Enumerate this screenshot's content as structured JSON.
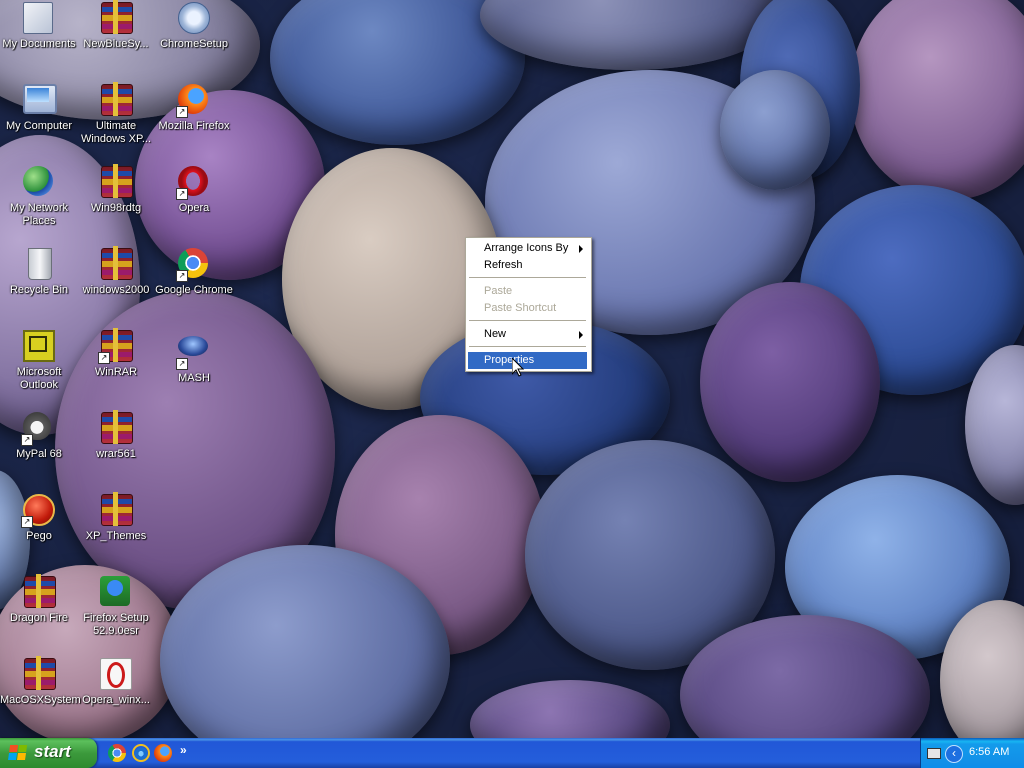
{
  "desktop": {
    "icons": [
      {
        "label": "My Documents",
        "icon": "my-documents-icon"
      },
      {
        "label": "NewBlueSy...",
        "icon": "winrar-archive-icon"
      },
      {
        "label": "ChromeSetup",
        "icon": "chrome-setup-icon"
      },
      {
        "label": "My Computer",
        "icon": "my-computer-icon"
      },
      {
        "label": "Ultimate Windows XP...",
        "icon": "winrar-archive-icon"
      },
      {
        "label": "Mozilla Firefox",
        "icon": "firefox-icon"
      },
      {
        "label": "My Network Places",
        "icon": "network-places-icon"
      },
      {
        "label": "Win98rdtg",
        "icon": "winrar-archive-icon"
      },
      {
        "label": "Opera",
        "icon": "opera-icon"
      },
      {
        "label": "Recycle Bin",
        "icon": "recycle-bin-icon"
      },
      {
        "label": "windows2000",
        "icon": "winrar-archive-icon"
      },
      {
        "label": "Google Chrome",
        "icon": "chrome-icon"
      },
      {
        "label": "Microsoft Outlook",
        "icon": "outlook-icon"
      },
      {
        "label": "WinRAR",
        "icon": "winrar-icon"
      },
      {
        "label": "MASH",
        "icon": "mash-icon"
      },
      {
        "label": "MyPal 68",
        "icon": "mypal-icon"
      },
      {
        "label": "wrar561",
        "icon": "winrar-archive-icon"
      },
      {
        "label": "Pego",
        "icon": "pego-icon"
      },
      {
        "label": "XP_Themes",
        "icon": "winrar-archive-icon"
      },
      {
        "label": "Dragon Fire",
        "icon": "winrar-archive-icon"
      },
      {
        "label": "Firefox Setup 52.9.0esr",
        "icon": "firefox-setup-icon"
      },
      {
        "label": "MacOSXSystem",
        "icon": "winrar-archive-icon"
      },
      {
        "label": "Opera_winx...",
        "icon": "opera-installer-icon"
      }
    ]
  },
  "context_menu": {
    "items": [
      {
        "label": "Arrange Icons By",
        "enabled": true,
        "submenu": true
      },
      {
        "label": "Refresh",
        "enabled": true
      },
      {
        "label": "Paste",
        "enabled": false
      },
      {
        "label": "Paste Shortcut",
        "enabled": false
      },
      {
        "label": "New",
        "enabled": true,
        "submenu": true
      },
      {
        "label": "Properties",
        "enabled": true,
        "highlighted": true
      }
    ]
  },
  "taskbar": {
    "start_label": "start",
    "quick_launch": [
      "chrome-icon",
      "internet-explorer-icon",
      "firefox-icon"
    ],
    "quick_launch_more": "»",
    "tray": {
      "clock": "6:56 AM",
      "chevron": "‹"
    }
  },
  "colors": {
    "taskbar_blue": "#245edb",
    "start_green": "#3c9a3c",
    "menu_highlight": "#316ac5",
    "menu_disabled": "#aca899"
  }
}
